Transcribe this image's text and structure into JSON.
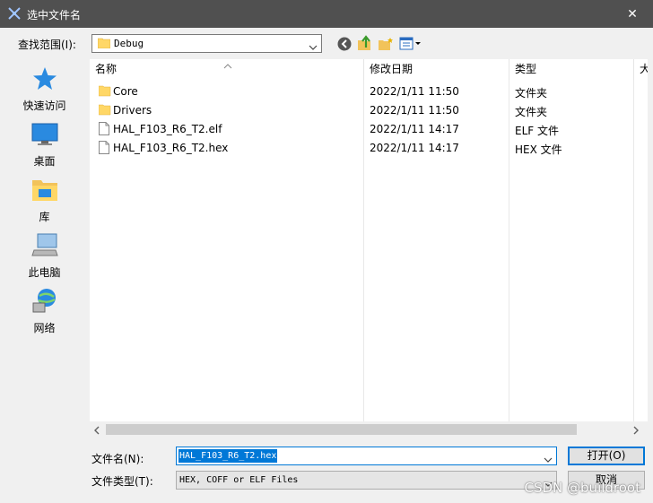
{
  "window": {
    "title": "选中文件名",
    "close_glyph": "✕"
  },
  "toolbar": {
    "look_in_label": "查找范围(I):",
    "look_in_value": "Debug",
    "icons": [
      "back-icon",
      "up-folder-icon",
      "new-folder-icon",
      "view-menu-icon"
    ]
  },
  "places": [
    {
      "label": "快速访问",
      "icon": "star-icon"
    },
    {
      "label": "桌面",
      "icon": "desktop-icon"
    },
    {
      "label": "库",
      "icon": "library-icon"
    },
    {
      "label": "此电脑",
      "icon": "computer-icon"
    },
    {
      "label": "网络",
      "icon": "network-icon"
    }
  ],
  "columns": [
    "名称",
    "修改日期",
    "类型",
    "大"
  ],
  "files": [
    {
      "name": "Core",
      "date": "2022/1/11 11:50",
      "type": "文件夹",
      "icon": "folder-icon"
    },
    {
      "name": "Drivers",
      "date": "2022/1/11 11:50",
      "type": "文件夹",
      "icon": "folder-icon"
    },
    {
      "name": "HAL_F103_R6_T2.elf",
      "date": "2022/1/11 14:17",
      "type": "ELF 文件",
      "icon": "file-icon"
    },
    {
      "name": "HAL_F103_R6_T2.hex",
      "date": "2022/1/11 14:17",
      "type": "HEX 文件",
      "icon": "file-icon"
    }
  ],
  "form": {
    "file_name_label": "文件名(N):",
    "file_name_value": "HAL_F103_R6_T2.hex",
    "file_type_label": "文件类型(T):",
    "file_type_value": "HEX, COFF or ELF Files"
  },
  "buttons": {
    "open": "打开(O)",
    "cancel": "取消"
  },
  "watermark": "CSDN @buildroot",
  "colors": {
    "titlebar": "#505050",
    "accent": "#0078d7",
    "folder": "#ffd766"
  }
}
